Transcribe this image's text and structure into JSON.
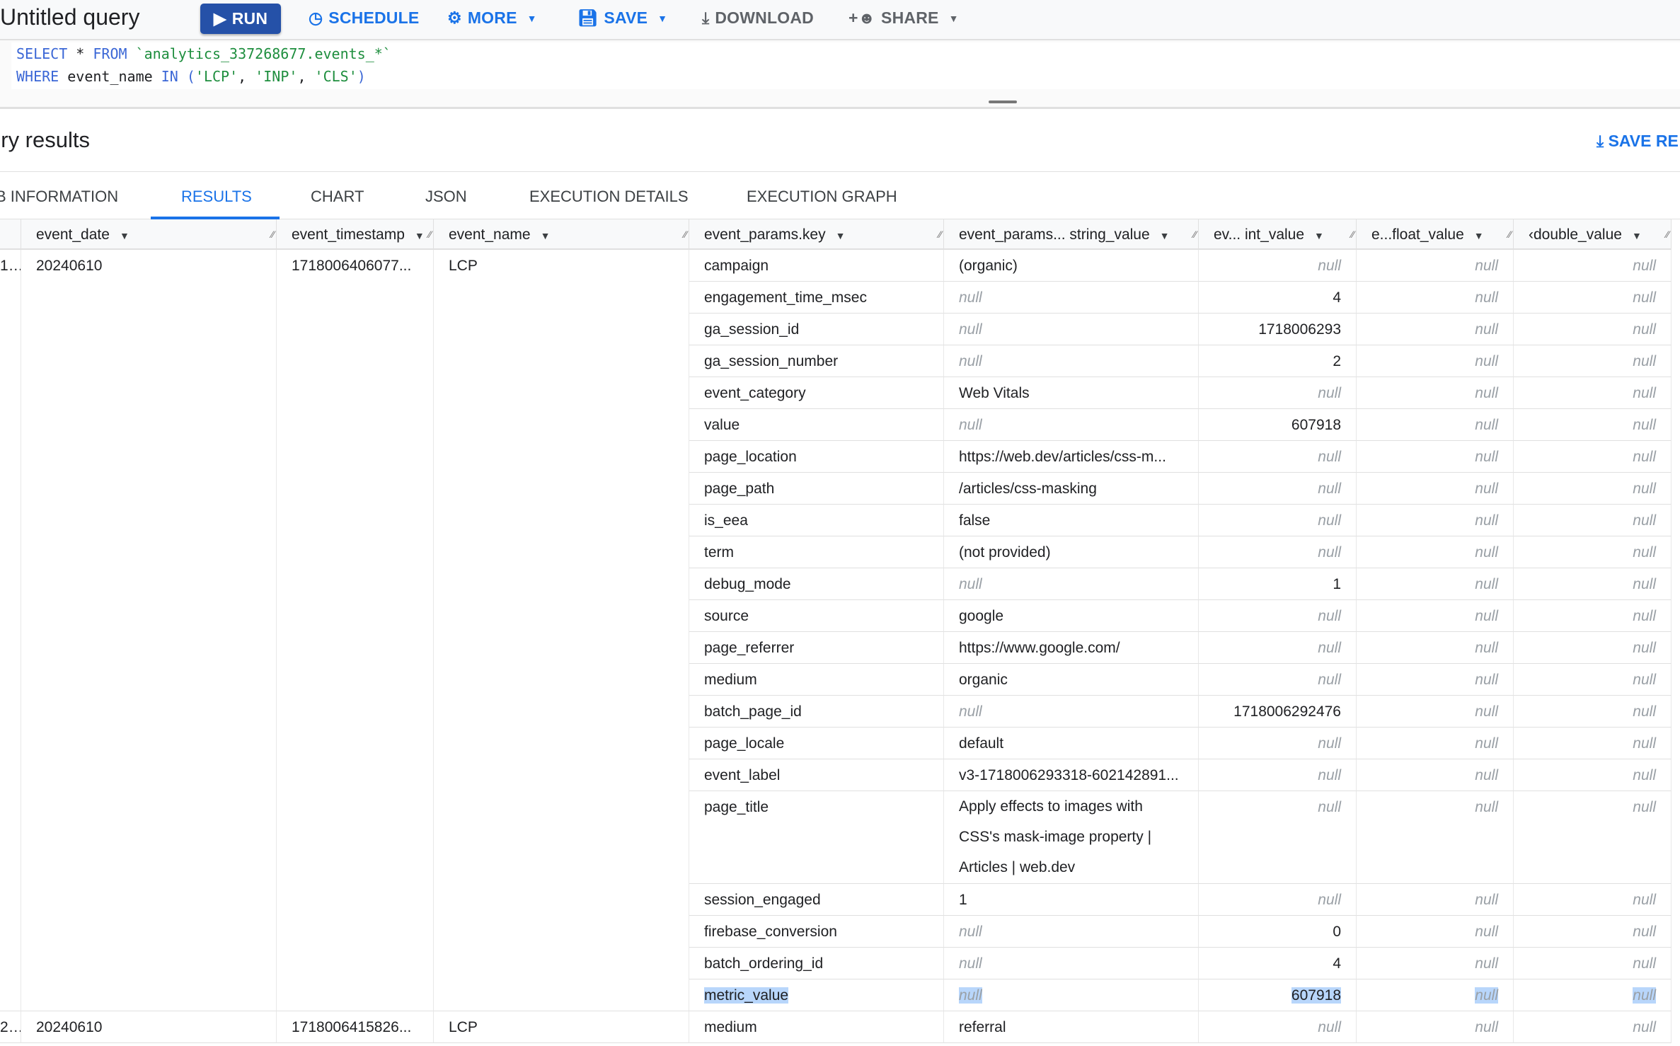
{
  "toolbar": {
    "title": "Untitled query",
    "run": "RUN",
    "schedule": "SCHEDULE",
    "more": "MORE",
    "save": "SAVE",
    "download": "DOWNLOAD",
    "share": "SHARE"
  },
  "editor": {
    "line1": {
      "kw1": "SELECT",
      "star": " * ",
      "kw2": "FROM",
      "table": " `analytics_337268677.events_*`"
    },
    "line2": {
      "kw1": "WHERE",
      "col": " event_name ",
      "kw2": "IN",
      "open": " (",
      "v1": "'LCP'",
      "v2": "'INP'",
      "v3": "'CLS'",
      "close": ")"
    }
  },
  "results": {
    "title": "ery results",
    "save_results": "SAVE RE"
  },
  "tabs": [
    "B INFORMATION",
    "RESULTS",
    "CHART",
    "JSON",
    "EXECUTION DETAILS",
    "EXECUTION GRAPH"
  ],
  "active_tab": "RESULTS",
  "columns": [
    "event_date",
    "event_timestamp",
    "event_name",
    "event_params.key",
    "event_params... string_value",
    "ev... int_value",
    "e...float_value",
    "‹double_value"
  ],
  "null_label": "null",
  "rows": [
    {
      "row": "1",
      "event_date": "20240610",
      "event_timestamp": "1718006406077...",
      "event_name": "LCP",
      "params": [
        [
          "campaign",
          "(organic)",
          null,
          null,
          null
        ],
        [
          "engagement_time_msec",
          null,
          "4",
          null,
          null
        ],
        [
          "ga_session_id",
          null,
          "1718006293",
          null,
          null
        ],
        [
          "ga_session_number",
          null,
          "2",
          null,
          null
        ],
        [
          "event_category",
          "Web Vitals",
          null,
          null,
          null
        ],
        [
          "value",
          null,
          "607918",
          null,
          null
        ],
        [
          "page_location",
          "https://web.dev/articles/css-m...",
          null,
          null,
          null
        ],
        [
          "page_path",
          "/articles/css-masking",
          null,
          null,
          null
        ],
        [
          "is_eea",
          "false",
          null,
          null,
          null
        ],
        [
          "term",
          "(not provided)",
          null,
          null,
          null
        ],
        [
          "debug_mode",
          null,
          "1",
          null,
          null
        ],
        [
          "source",
          "google",
          null,
          null,
          null
        ],
        [
          "page_referrer",
          "https://www.google.com/",
          null,
          null,
          null
        ],
        [
          "medium",
          "organic",
          null,
          null,
          null
        ],
        [
          "batch_page_id",
          null,
          "1718006292476",
          null,
          null
        ],
        [
          "page_locale",
          "default",
          null,
          null,
          null
        ],
        [
          "event_label",
          "v3-1718006293318-602142891...",
          null,
          null,
          null
        ],
        [
          "page_title",
          "Apply effects to images with CSS's mask-image property | Articles | web.dev",
          null,
          null,
          null
        ],
        [
          "session_engaged",
          "1",
          null,
          null,
          null
        ],
        [
          "firebase_conversion",
          null,
          "0",
          null,
          null
        ],
        [
          "batch_ordering_id",
          null,
          "4",
          null,
          null
        ],
        [
          "metric_value",
          null,
          "607918",
          null,
          null
        ]
      ]
    },
    {
      "row": "2",
      "event_date": "20240610",
      "event_timestamp": "1718006415826...",
      "event_name": "LCP",
      "params": [
        [
          "medium",
          "referral",
          null,
          null,
          null
        ]
      ]
    }
  ],
  "selected_param": "metric_value"
}
